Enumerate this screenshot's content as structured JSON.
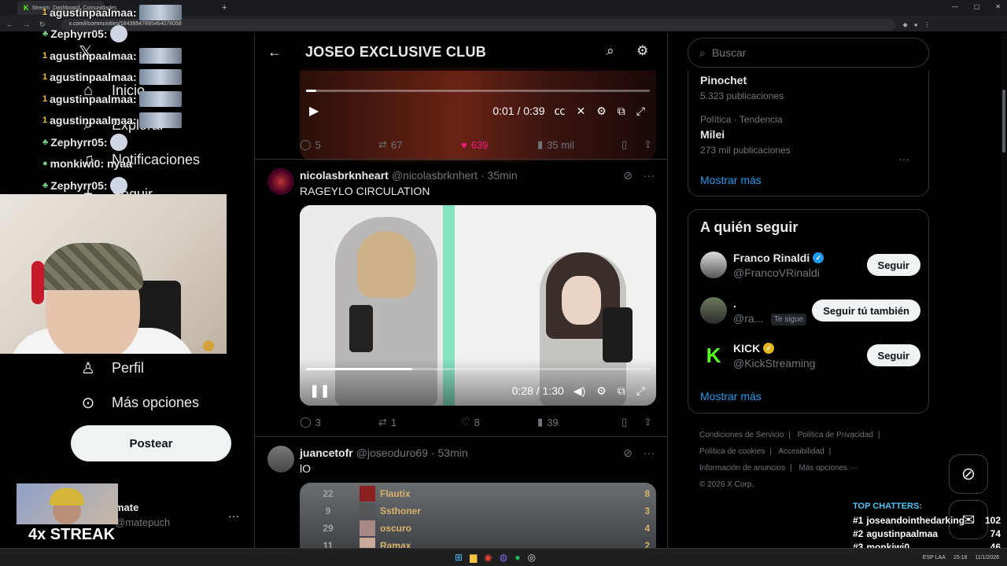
{
  "browser": {
    "tab1_label": "Stream",
    "tab2_label": "Dashboard",
    "tab3_label": "Comunidades",
    "url": "x.com/i/communities/18439547895464078058",
    "new_tab": "+"
  },
  "chat_overlay": [
    {
      "badge": "1",
      "user": "agustinpaalmaa:",
      "emote": "wide"
    },
    {
      "badge": "♣",
      "user": "Zephyrr05:",
      "emote": "small"
    },
    {
      "badge": "1",
      "user": "agustinpaalmaa:",
      "emote": "wide"
    },
    {
      "badge": "1",
      "user": "agustinpaalmaa:",
      "emote": "wide"
    },
    {
      "badge": "1",
      "user": "agustinpaalmaa:",
      "emote": "wide"
    },
    {
      "badge": "1",
      "user": "agustinpaalmaa:",
      "emote": "wide"
    },
    {
      "badge": "♣",
      "user": "Zephyrr05:",
      "emote": "small"
    },
    {
      "badge": "●",
      "user": "monkiwi0: nyaa",
      "emote": "none"
    },
    {
      "badge": "♣",
      "user": "Zephyrr05:",
      "emote": "small"
    }
  ],
  "sidebar": {
    "home": "Inicio",
    "explore": "Explorar",
    "notifications": "Notificaciones",
    "follow": "Seguir",
    "profile": "Perfil",
    "more": "Más opciones",
    "post_button": "Postear",
    "account_name": "mate",
    "account_handle": "@matepuch",
    "streak": "4x STREAK"
  },
  "header": {
    "title": "JOSEO EXCLUSIVE CLUB"
  },
  "post1": {
    "video_time": "0:01 / 0:39",
    "video_progress": 0.03,
    "replies": "5",
    "reposts": "67",
    "likes": "639",
    "views": "35 mil"
  },
  "post2": {
    "name": "nicolasbrknheart",
    "handle": "@nicolasbrknhert",
    "time": "· 35min",
    "text": "RAGEYLO CIRCULATION",
    "video_time": "0:28 / 1:30",
    "video_progress": 0.31,
    "replies": "3",
    "reposts": "1",
    "likes": "8",
    "views": "39"
  },
  "post3": {
    "name": "juancetofr",
    "handle": "@joseoduro69",
    "time": "· 53min",
    "text": "lO",
    "leaderboard": [
      {
        "rank": "22",
        "name": "Flautix",
        "score": "8"
      },
      {
        "rank": "9",
        "name": "Ssthoner",
        "score": "3"
      },
      {
        "rank": "29",
        "name": "oscuro",
        "score": "4"
      },
      {
        "rank": "11",
        "name": "Ramax",
        "score": "2"
      }
    ]
  },
  "search": {
    "placeholder": "Buscar"
  },
  "trends": [
    {
      "category": "",
      "name": "Pinochet",
      "count": "5.323 publicaciones"
    },
    {
      "category": "Política · Tendencia",
      "name": "Milei",
      "count": "273 mil publicaciones"
    }
  ],
  "show_more": "Mostrar más",
  "who_to_follow": {
    "title": "A quién seguir",
    "users": [
      {
        "name": "Franco Rinaldi",
        "handle": "@FrancoVRinaldi",
        "button": "Seguir",
        "badge": "blue",
        "follows_you": ""
      },
      {
        "name": ".",
        "handle": "@ra...",
        "button": "Seguir tú también",
        "badge": "",
        "follows_you": "Te sigue"
      },
      {
        "name": "KICK",
        "handle": "@KickStreaming",
        "button": "Seguir",
        "badge": "gold",
        "follows_you": ""
      }
    ],
    "show_more": "Mostrar más"
  },
  "footer": {
    "terms": "Condiciones de Servicio",
    "privacy": "Política de Privacidad",
    "cookies": "Política de cookies",
    "accessibility": "Accesibilidad",
    "ads": "Información de anuncios",
    "more": "Más opciones ···",
    "copyright": "© 2026 X Corp."
  },
  "top_chatters": {
    "title": "TOP CHATTERS:",
    "rows": [
      {
        "rank": "#1",
        "name": "joseandointhedarking",
        "count": "102"
      },
      {
        "rank": "#2",
        "name": "agustinpaalmaa",
        "count": "74"
      },
      {
        "rank": "#3",
        "name": "monkiwi0",
        "count": "46"
      }
    ]
  },
  "taskbar": {
    "lang": "ESP LAA",
    "time": "15:18",
    "date": "11/1/2026"
  },
  "colors": {
    "accent": "#1d9bf0",
    "like": "#f91880",
    "kick_green": "#53fc18"
  }
}
